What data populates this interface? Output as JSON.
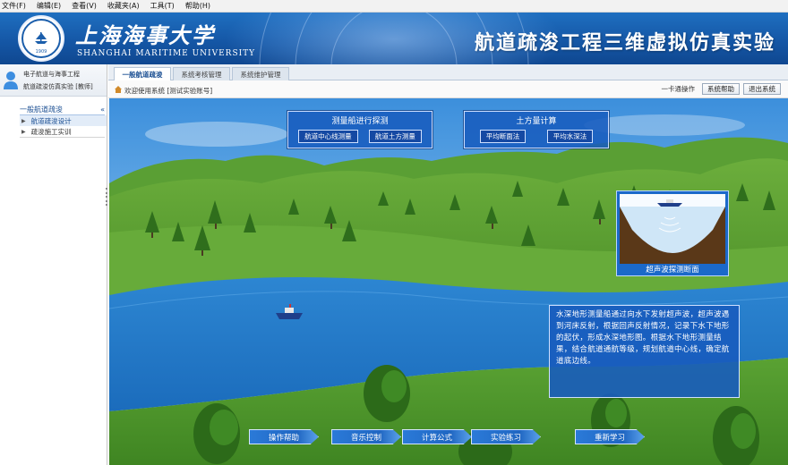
{
  "menu": [
    "文件(F)",
    "编辑(E)",
    "查看(V)",
    "收藏夹(A)",
    "工具(T)",
    "帮助(H)"
  ],
  "banner": {
    "university_cn": "上海海事大学",
    "university_en": "SHANGHAI MARITIME UNIVERSITY",
    "system_title": "航道疏浚工程三维虚拟仿真实验",
    "seal_year": "1909"
  },
  "sidebar": {
    "user_line1": "电子航道与海事工程",
    "user_line2": "航道疏浚仿真实验 [教师]",
    "section_title": "一般航道疏浚",
    "collapse_icon": "«",
    "items": [
      {
        "label": "航道疏浚设计"
      },
      {
        "label": "疏浚施工实训"
      }
    ]
  },
  "tabs": [
    {
      "label": "一般航道疏浚"
    },
    {
      "label": "系统考核管理"
    },
    {
      "label": "系统维护管理"
    }
  ],
  "toolbar": {
    "welcome": "欢迎使用系统 [测试实验账号]",
    "label": "一卡通操作",
    "btn_help": "系统帮助",
    "btn_exit": "退出系统"
  },
  "scene": {
    "panel_left": {
      "title": "测量船进行探测",
      "btn1": "航道中心线测量",
      "btn2": "航道土方测量"
    },
    "panel_right": {
      "title": "土方量计算",
      "btn1": "平均断面法",
      "btn2": "平均水深法"
    },
    "sonar_caption": "超声波探测断面",
    "info_text": "水深地形测量船通过向水下发射超声波，超声波遇到河床反射，根据回声反射情况，记录下水下地形的起伏，形成水深地形图。根据水下地形测量结果，结合航道通航等级，规划航道中心线，确定航道底边线。",
    "bottom_buttons": [
      "操作帮助",
      "音乐控制",
      "计算公式",
      "实验练习",
      "重新学习"
    ]
  },
  "colors": {
    "banner": "#1557a6",
    "panel": "#185cbe",
    "river": "#1f78c8",
    "grass": "#4f9a2e"
  }
}
